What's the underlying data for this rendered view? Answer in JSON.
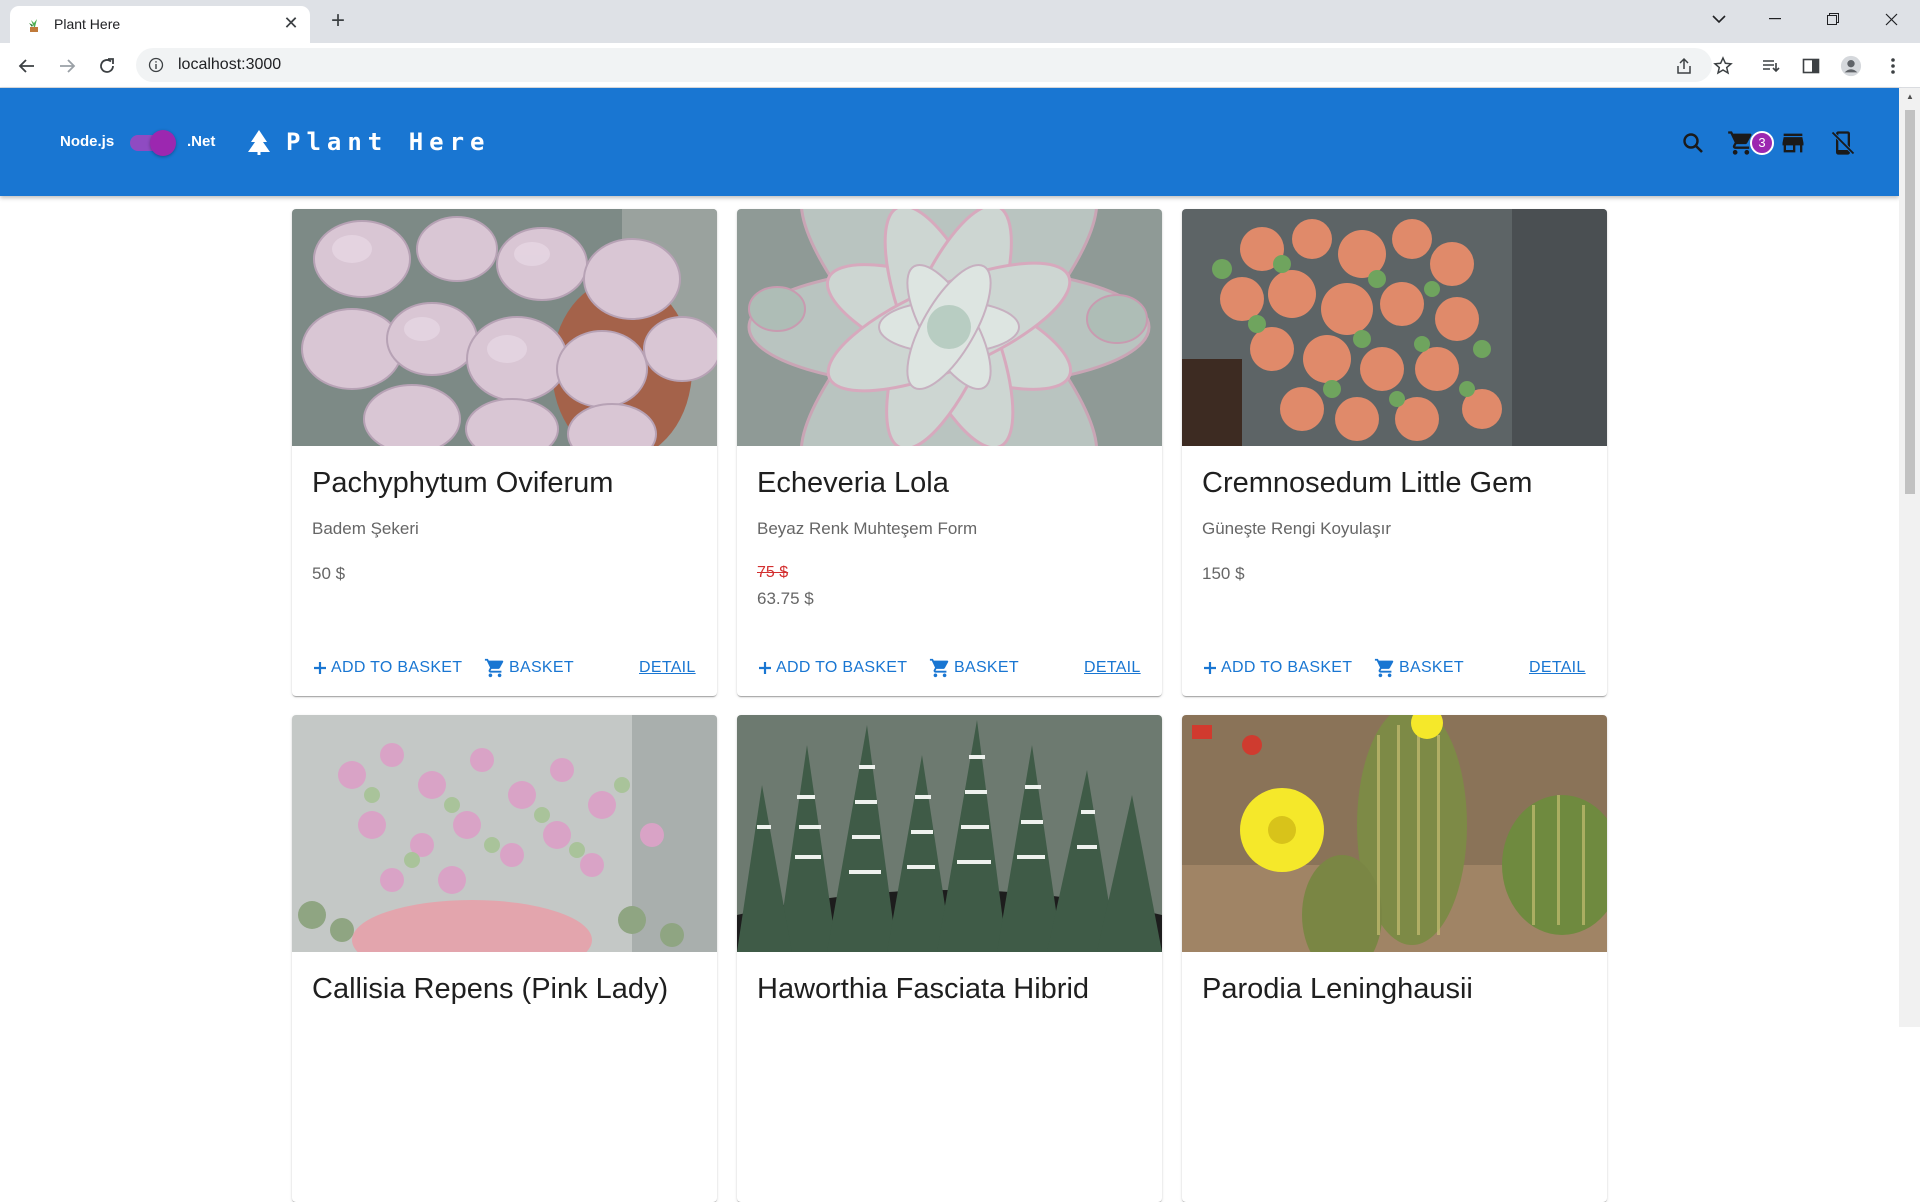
{
  "browser": {
    "tab_title": "Plant Here",
    "url": "localhost:3000"
  },
  "appbar": {
    "toggle_left": "Node.js",
    "toggle_right": ".Net",
    "brand": "Plant Here",
    "cart_count": "3",
    "color": "#1976d2",
    "accent": "#9c27b0"
  },
  "products": [
    {
      "name": "Pachyphytum Oviferum",
      "description": "Badem Şekeri",
      "price": "50 $",
      "old_price": null
    },
    {
      "name": "Echeveria Lola",
      "description": "Beyaz Renk Muhteşem Form",
      "price": "63.75 $",
      "old_price": "75 $"
    },
    {
      "name": "Cremnosedum Little Gem",
      "description": "Güneşte Rengi Koyulaşır",
      "price": "150 $",
      "old_price": null
    },
    {
      "name": "Callisia Repens (Pink Lady)"
    },
    {
      "name": "Haworthia Fasciata Hibrid"
    },
    {
      "name": "Parodia Leninghausii"
    }
  ],
  "actions": {
    "add": "ADD TO BASKET",
    "basket": "BASKET",
    "detail": "DETAIL"
  }
}
